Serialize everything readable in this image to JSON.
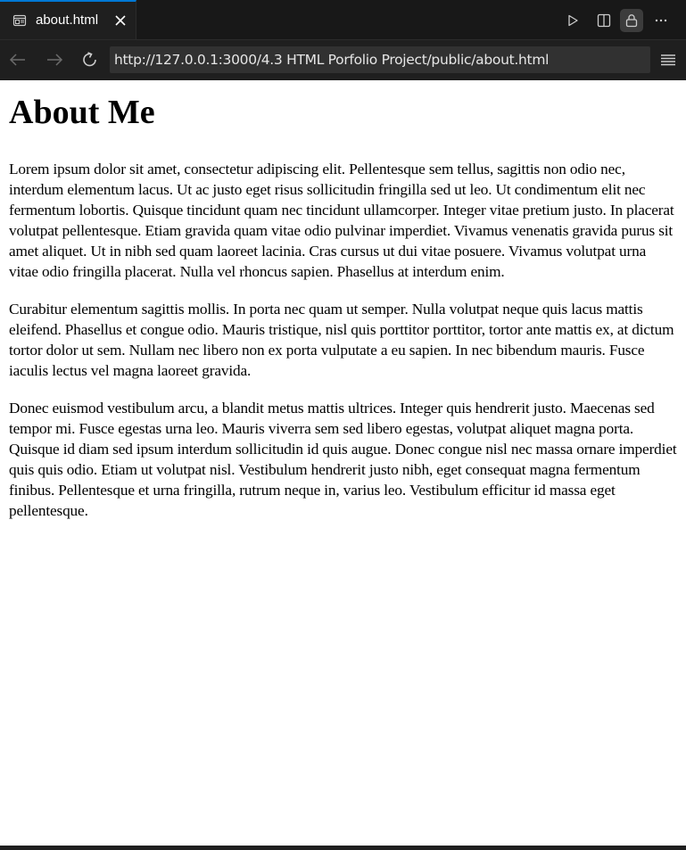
{
  "tab": {
    "label": "about.html",
    "icon": "preview-icon",
    "close_icon": "close-icon"
  },
  "tab_actions": [
    {
      "name": "run-icon"
    },
    {
      "name": "split-editor-icon"
    },
    {
      "name": "lock-icon",
      "active": true
    },
    {
      "name": "more-actions-icon"
    }
  ],
  "nav": {
    "back_icon": "arrow-left-icon",
    "forward_icon": "arrow-right-icon",
    "reload_icon": "reload-icon",
    "url": "http://127.0.0.1:3000/4.3 HTML Porfolio Project/public/about.html",
    "menu_icon": "menu-icon"
  },
  "page": {
    "heading": "About Me",
    "paragraphs": [
      "Lorem ipsum dolor sit amet, consectetur adipiscing elit. Pellentesque sem tellus, sagittis non odio nec, interdum elementum lacus. Ut ac justo eget risus sollicitudin fringilla sed ut leo. Ut condimentum elit nec fermentum lobortis. Quisque tincidunt quam nec tincidunt ullamcorper. Integer vitae pretium justo. In placerat volutpat pellentesque. Etiam gravida quam vitae odio pulvinar imperdiet. Vivamus venenatis gravida purus sit amet aliquet. Ut in nibh sed quam laoreet lacinia. Cras cursus ut dui vitae posuere. Vivamus volutpat urna vitae odio fringilla placerat. Nulla vel rhoncus sapien. Phasellus at interdum enim.",
      "Curabitur elementum sagittis mollis. In porta nec quam ut semper. Nulla volutpat neque quis lacus mattis eleifend. Phasellus et congue odio. Mauris tristique, nisl quis porttitor porttitor, tortor ante mattis ex, at dictum tortor dolor ut sem. Nullam nec libero non ex porta vulputate a eu sapien. In nec bibendum mauris. Fusce iaculis lectus vel magna laoreet gravida.",
      "Donec euismod vestibulum arcu, a blandit metus mattis ultrices. Integer quis hendrerit justo. Maecenas sed tempor mi. Fusce egestas urna leo. Mauris viverra sem sed libero egestas, volutpat aliquet magna porta. Quisque id diam sed ipsum interdum sollicitudin id quis augue. Donec congue nisl nec massa ornare imperdiet quis quis odio. Etiam ut volutpat nisl. Vestibulum hendrerit justo nibh, eget consequat magna fermentum finibus. Pellentesque et urna fringilla, rutrum neque in, varius leo. Vestibulum efficitur id massa eget pellentesque."
    ]
  },
  "colors": {
    "chrome_background": "#181818",
    "tab_active_border": "#0078d4",
    "url_background": "#313131",
    "page_background": "#ffffff"
  }
}
